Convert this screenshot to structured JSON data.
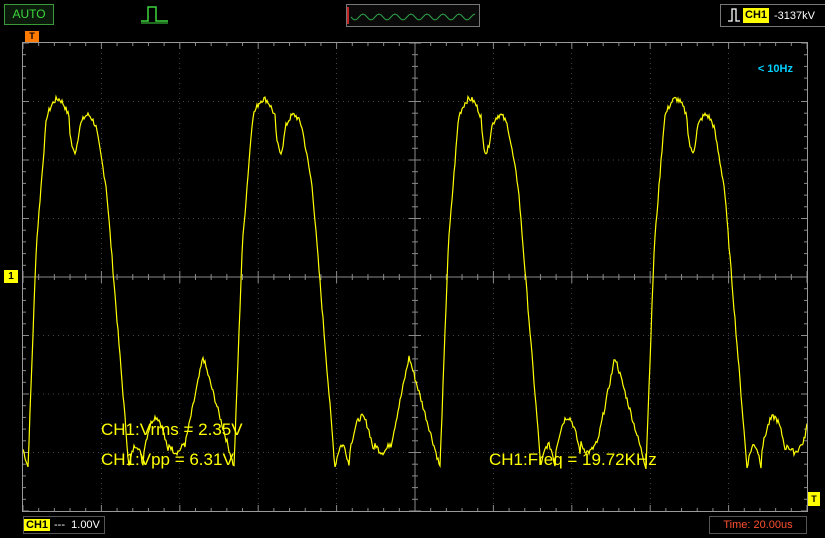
{
  "toolbar": {
    "mode": "AUTO",
    "trigger_channel": "CH1",
    "trigger_level": "-3137kV"
  },
  "markers": {
    "trigger_time": "T",
    "channel1": "1",
    "trigger_level": "T"
  },
  "screen": {
    "freq_cap": "< 10Hz",
    "measurements": {
      "vrms": "CH1:Vrms = 2.35V",
      "vpp": "CH1:Vpp = 6.31V",
      "freq": "CH1:Freq = 19.72KHz"
    }
  },
  "bottombar": {
    "channel": "CH1",
    "coupling": "---",
    "volts_per_div": "1.00V",
    "timebase": "Time: 20.00us"
  },
  "colors": {
    "trace": "#ffff00",
    "grid": "#8a8a8a",
    "mode": "#3ed63e",
    "timebase": "#ff5030",
    "freq_cap": "#00d0ff"
  }
}
